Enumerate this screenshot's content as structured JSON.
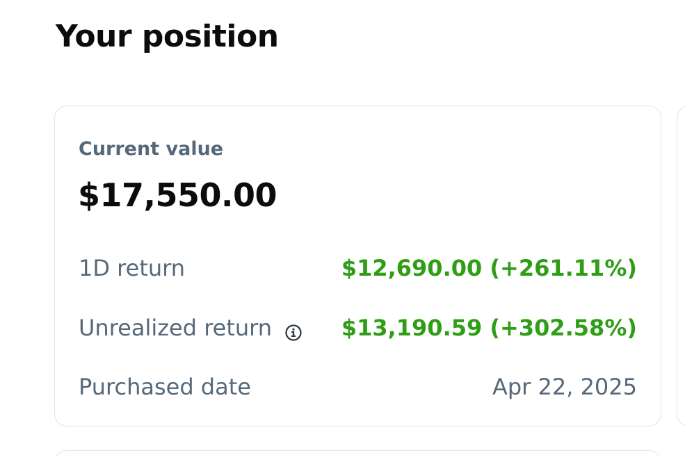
{
  "header": {
    "title": "Your position"
  },
  "position_card": {
    "current_value_label": "Current value",
    "current_value": "$17,550.00",
    "rows": [
      {
        "label": "1D return",
        "value": "$12,690.00 (+261.11%)",
        "style": "positive"
      },
      {
        "label": "Unrealized return",
        "value": "$13,190.59 (+302.58%)",
        "style": "positive",
        "icon": "info-icon"
      },
      {
        "label": "Purchased date",
        "value": "Apr 22, 2025",
        "style": "neutral"
      }
    ]
  },
  "colors": {
    "positive": "#2f9e16",
    "label": "#56687a",
    "border": "#dfe3e8",
    "text": "#0a0c0e"
  }
}
